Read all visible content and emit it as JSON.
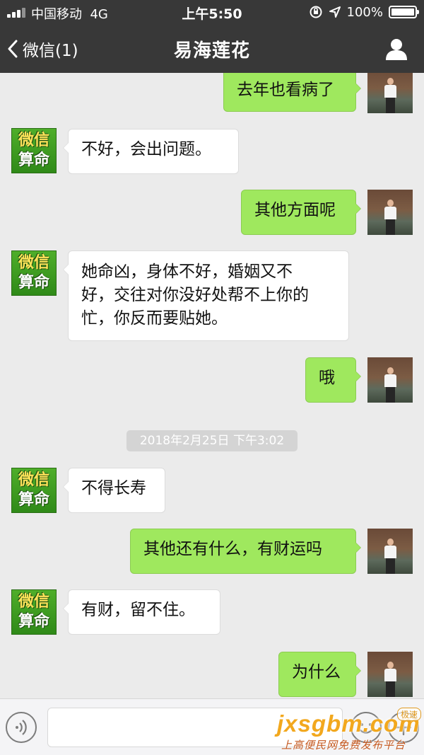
{
  "status_bar": {
    "carrier": "中国移动",
    "network": "4G",
    "time": "上午5:50",
    "battery": "100%",
    "battery_level": 1.0
  },
  "nav": {
    "back_label": "微信(1)",
    "title": "易海莲花",
    "icons": {
      "back": "chevron-left-icon",
      "profile": "person-icon"
    }
  },
  "contact_avatar": {
    "line1": "微信",
    "line2": "算命"
  },
  "messages": [
    {
      "side": "right",
      "text": "去年也看病了"
    },
    {
      "side": "left",
      "text": "不好，会出问题。"
    },
    {
      "side": "right",
      "text": "其他方面呢"
    },
    {
      "side": "left",
      "lines": [
        "她命凶，身体不好，婚姻又不",
        "好，交往对你没好处帮不上你的",
        "忙，你反而要贴她。"
      ]
    },
    {
      "side": "right",
      "text": "哦"
    },
    {
      "side": "left",
      "text": "不得长寿"
    },
    {
      "side": "right",
      "text": "其他还有什么，有财运吗"
    },
    {
      "side": "left",
      "text": "有财，留不住。"
    },
    {
      "side": "right",
      "text": "为什么"
    }
  ],
  "timestamp": "2018年2月25日 下午3:02",
  "input_bar": {
    "icons": {
      "voice": "voice-icon",
      "emoji": "emoji-icon",
      "more": "plus-icon"
    }
  },
  "watermark": {
    "logo": "jxsgbm.com",
    "badge": "极速",
    "tagline": "上高便民网免费发布平台"
  },
  "colors": {
    "header_bg": "#383838",
    "chat_bg": "#ebebeb",
    "sent_bubble": "#9fe85e",
    "received_bubble": "#ffffff"
  }
}
